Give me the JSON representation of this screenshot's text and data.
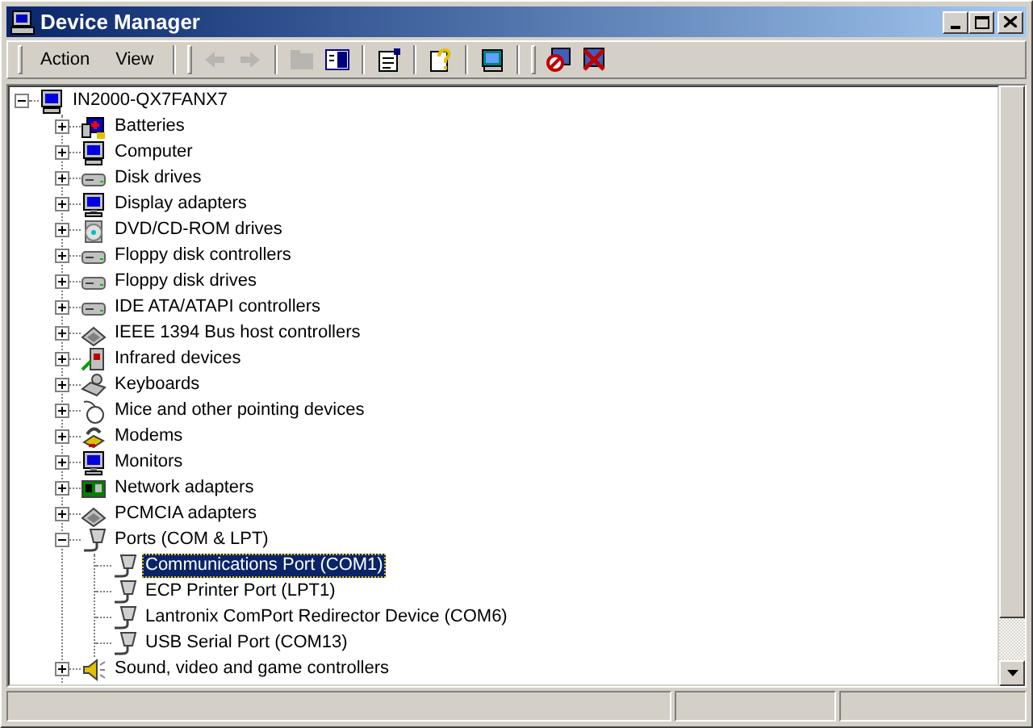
{
  "window": {
    "title": "Device Manager"
  },
  "menu": [
    {
      "label": "Action"
    },
    {
      "label": "View"
    }
  ],
  "toolbar": [
    [
      {
        "disabled": true
      },
      {
        "disabled": true
      }
    ],
    [
      {
        "disabled": true
      },
      {
        "disabled": false
      }
    ],
    [
      {
        "disabled": false
      }
    ],
    [
      {
        "disabled": false
      }
    ],
    [
      {
        "disabled": false
      }
    ],
    [
      {
        "disabled": false
      },
      {
        "disabled": false
      }
    ]
  ],
  "tree": {
    "label": "IN2000-QX7FANX7",
    "expanded": true,
    "selected": false,
    "children": [
      {
        "label": "Batteries",
        "expanded": false,
        "selected": false
      },
      {
        "label": "Computer",
        "expanded": false,
        "selected": false
      },
      {
        "label": "Disk drives",
        "expanded": false,
        "selected": false
      },
      {
        "label": "Display adapters",
        "expanded": false,
        "selected": false
      },
      {
        "label": "DVD/CD-ROM drives",
        "expanded": false,
        "selected": false
      },
      {
        "label": "Floppy disk controllers",
        "expanded": false,
        "selected": false
      },
      {
        "label": "Floppy disk drives",
        "expanded": false,
        "selected": false
      },
      {
        "label": "IDE ATA/ATAPI controllers",
        "expanded": false,
        "selected": false
      },
      {
        "label": "IEEE 1394 Bus host controllers",
        "expanded": false,
        "selected": false
      },
      {
        "label": "Infrared devices",
        "expanded": false,
        "selected": false
      },
      {
        "label": "Keyboards",
        "expanded": false,
        "selected": false
      },
      {
        "label": "Mice and other pointing devices",
        "expanded": false,
        "selected": false
      },
      {
        "label": "Modems",
        "expanded": false,
        "selected": false
      },
      {
        "label": "Monitors",
        "expanded": false,
        "selected": false
      },
      {
        "label": "Network adapters",
        "expanded": false,
        "selected": false
      },
      {
        "label": "PCMCIA adapters",
        "expanded": false,
        "selected": false
      },
      {
        "label": "Ports (COM & LPT)",
        "expanded": true,
        "selected": false,
        "children": [
          {
            "label": "Communications Port (COM1)",
            "selected": true
          },
          {
            "label": "ECP Printer Port (LPT1)",
            "selected": false
          },
          {
            "label": "Lantronix ComPort Redirector Device (COM6)",
            "selected": false
          },
          {
            "label": "USB Serial Port (COM13)",
            "selected": false
          }
        ]
      },
      {
        "label": "Sound, video and game controllers",
        "expanded": false,
        "selected": false
      }
    ]
  }
}
